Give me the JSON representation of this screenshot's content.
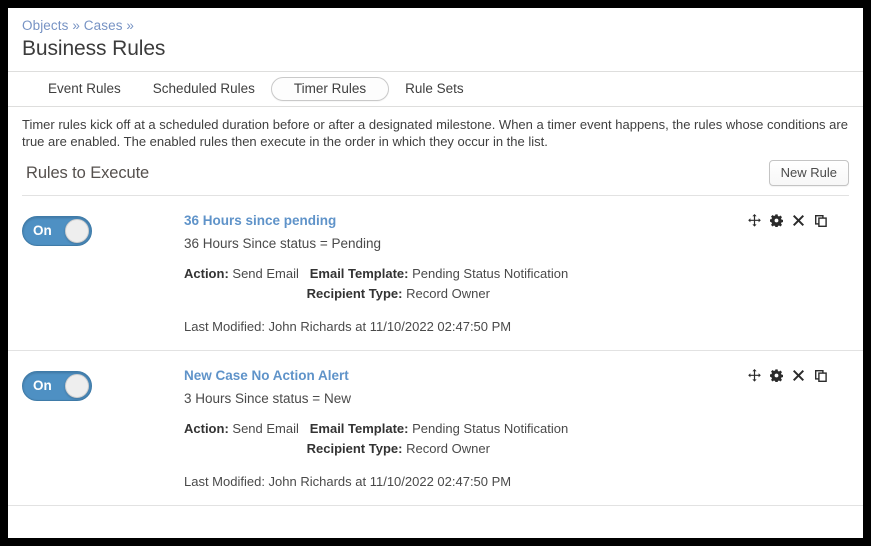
{
  "breadcrumb": {
    "items": [
      "Objects",
      "Cases"
    ],
    "separator": "»",
    "full": "Objects » Cases »"
  },
  "header": {
    "title": "Business Rules"
  },
  "tabs": [
    {
      "label": "Event Rules",
      "active": false
    },
    {
      "label": "Scheduled Rules",
      "active": false
    },
    {
      "label": "Timer Rules",
      "active": true
    },
    {
      "label": "Rule Sets",
      "active": false
    }
  ],
  "description": "Timer rules kick off at a scheduled duration before or after a designated milestone. When a timer event happens, the rules whose conditions are true are enabled. The enabled rules then execute in the order in which they occur in the list.",
  "section": {
    "title": "Rules to Execute",
    "new_rule_label": "New Rule"
  },
  "labels": {
    "action": "Action:",
    "email_template": "Email Template:",
    "recipient_type": "Recipient Type:",
    "last_modified_prefix": "Last Modified:"
  },
  "row_actions": [
    {
      "name": "move-icon",
      "title": "Move"
    },
    {
      "name": "settings-gear-icon",
      "title": "Settings"
    },
    {
      "name": "delete-close-icon",
      "title": "Delete"
    },
    {
      "name": "copy-icon",
      "title": "Copy"
    }
  ],
  "rules": [
    {
      "toggle_label": "On",
      "toggle_state": "on",
      "name": "36 Hours since pending",
      "condition": "36 Hours Since status = Pending",
      "action": "Send Email",
      "email_template": "Pending Status Notification",
      "recipient_type": "Record Owner",
      "last_modified": "Last Modified: John Richards at 11/10/2022 02:47:50 PM"
    },
    {
      "toggle_label": "On",
      "toggle_state": "on",
      "name": "New Case No Action Alert",
      "condition": "3 Hours Since status = New",
      "action": "Send Email",
      "email_template": "Pending Status Notification",
      "recipient_type": "Record Owner",
      "last_modified": "Last Modified: John Richards at 11/10/2022 02:47:50 PM"
    }
  ],
  "colors": {
    "link_blue": "#5f93c9",
    "breadcrumb_blue": "#7793c4",
    "toggle_on_blue": "#4e90c3",
    "text_dark": "#3c3c3c",
    "border_gray": "#e2e2e2"
  }
}
